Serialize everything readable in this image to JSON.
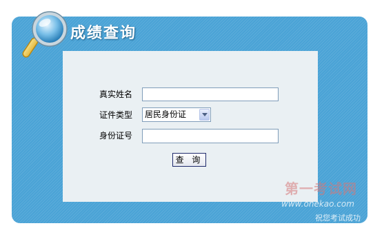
{
  "header": {
    "title": "成绩查询"
  },
  "form": {
    "name_label": "真实姓名",
    "name_value": "",
    "id_type_label": "证件类型",
    "id_type_selected": "居民身份证",
    "id_number_label": "身份证号",
    "id_number_value": "",
    "submit_label": "查 询"
  },
  "watermark": {
    "site_name": "第一考试网",
    "url": "www.onekao.com",
    "slogan": "祝您考试成功"
  },
  "colors": {
    "panel_blue": "#4aa3d6",
    "inner_bg": "#eaf0f3",
    "button_border": "#1e2a6b"
  }
}
